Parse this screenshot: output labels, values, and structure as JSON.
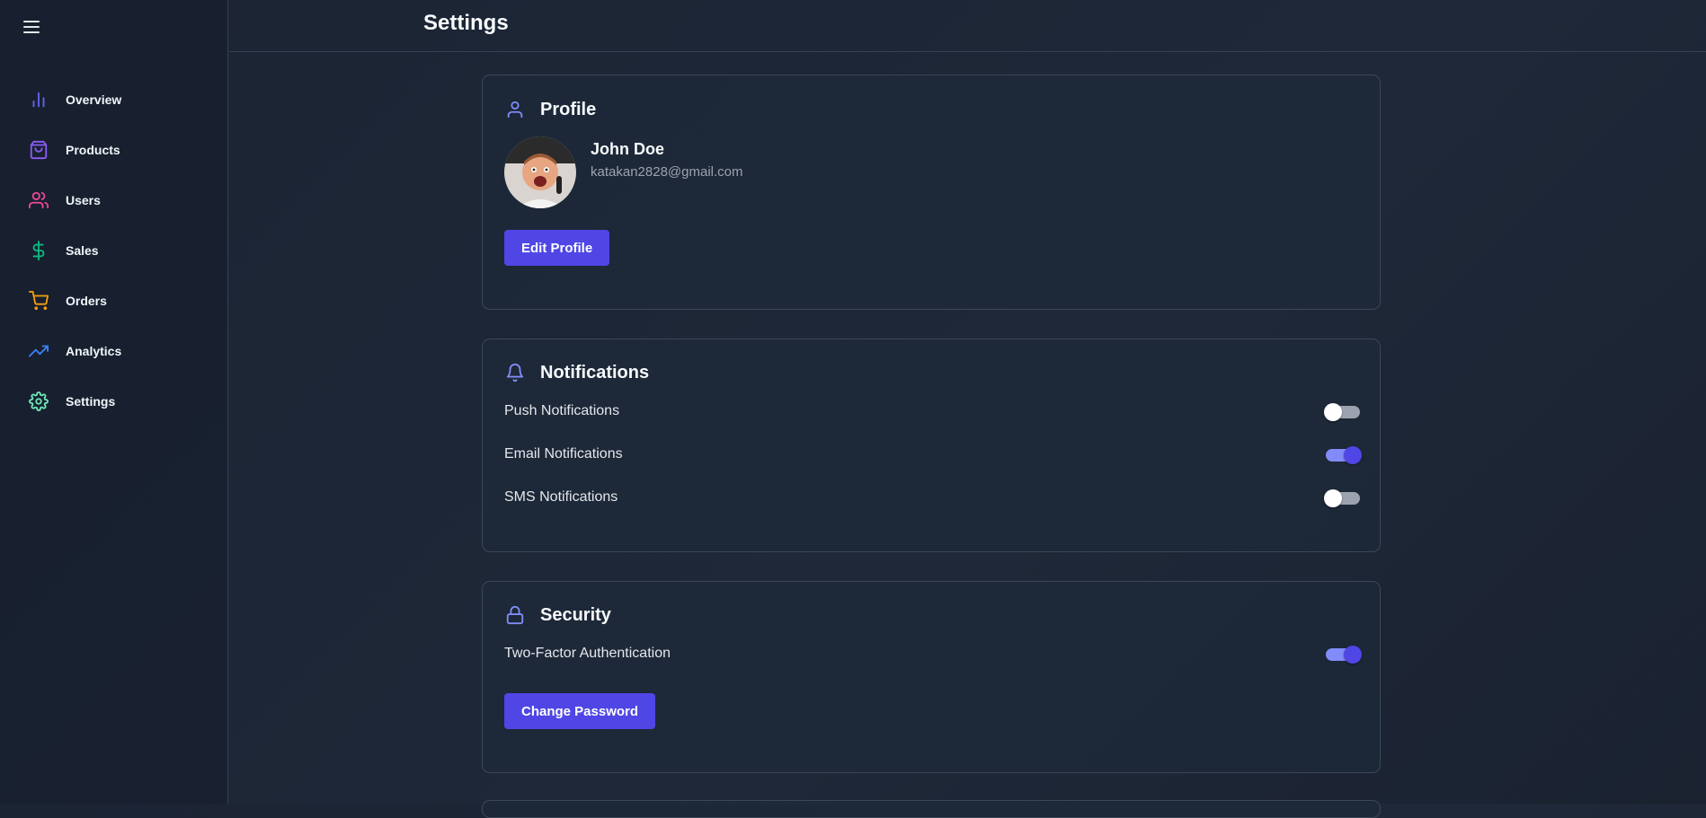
{
  "sidebar": {
    "menu_icon": "hamburger-icon",
    "items": [
      {
        "label": "Overview",
        "icon": "bar-chart-icon",
        "color": "#6366f1"
      },
      {
        "label": "Products",
        "icon": "shopping-bag-icon",
        "color": "#8b5cf6"
      },
      {
        "label": "Users",
        "icon": "users-icon",
        "color": "#ec4899"
      },
      {
        "label": "Sales",
        "icon": "dollar-sign-icon",
        "color": "#10b981"
      },
      {
        "label": "Orders",
        "icon": "shopping-cart-icon",
        "color": "#f59e0b"
      },
      {
        "label": "Analytics",
        "icon": "trending-up-icon",
        "color": "#3b82f6"
      },
      {
        "label": "Settings",
        "icon": "gear-icon",
        "color": "#6ee7b7"
      }
    ]
  },
  "header": {
    "title": "Settings"
  },
  "profile": {
    "title": "Profile",
    "name": "John Doe",
    "email": "katakan2828@gmail.com",
    "edit_label": "Edit Profile"
  },
  "notifications": {
    "title": "Notifications",
    "items": [
      {
        "label": "Push Notifications",
        "enabled": false
      },
      {
        "label": "Email Notifications",
        "enabled": true
      },
      {
        "label": "SMS Notifications",
        "enabled": false
      }
    ]
  },
  "security": {
    "title": "Security",
    "two_factor_label": "Two-Factor Authentication",
    "two_factor_enabled": true,
    "change_password_label": "Change Password"
  },
  "colors": {
    "accent": "#4f46e5",
    "icon_accent": "#818cf8"
  }
}
